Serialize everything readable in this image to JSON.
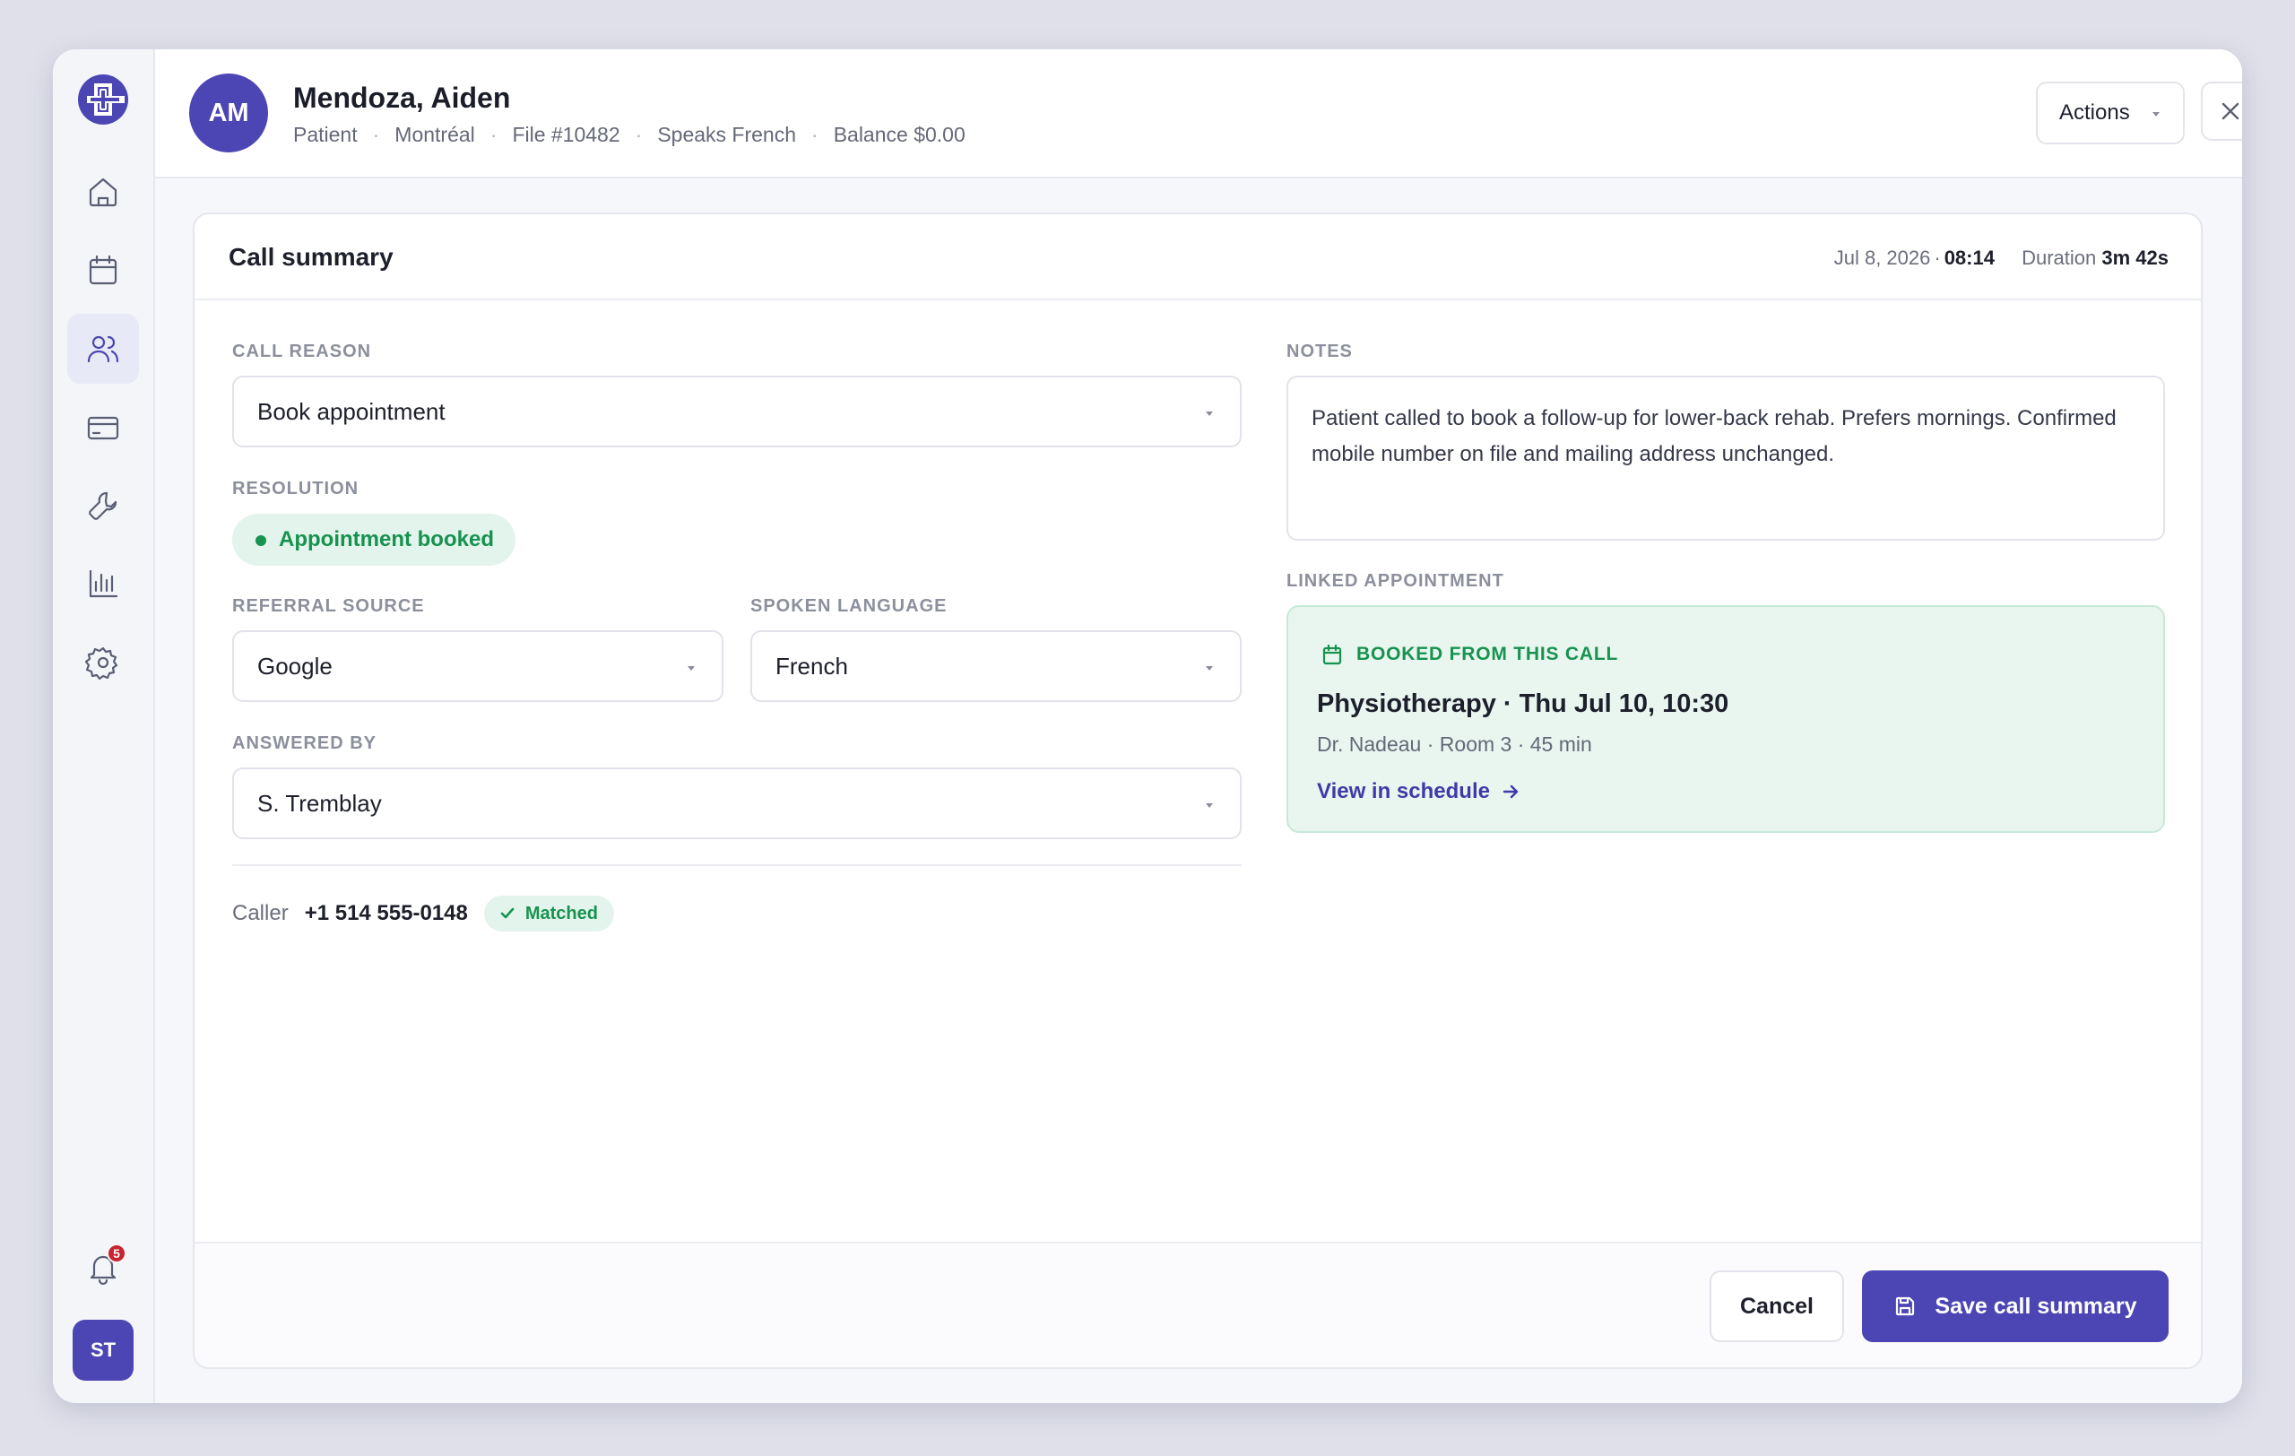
{
  "sidebar": {
    "items": [
      {
        "icon": "home-icon"
      },
      {
        "icon": "calendar-icon"
      },
      {
        "icon": "users-icon",
        "active": true
      },
      {
        "icon": "credit-card-icon"
      },
      {
        "icon": "wrench-icon"
      },
      {
        "icon": "bar-chart-icon"
      },
      {
        "icon": "gear-icon"
      }
    ],
    "notifications_count": "5",
    "user_initials": "ST"
  },
  "header": {
    "avatar_initials": "AM",
    "name": "Mendoza, Aiden",
    "meta": [
      "Patient",
      "Montréal",
      "File #10482",
      "Speaks French",
      "Balance $0.00"
    ],
    "actions_label": "Actions"
  },
  "card": {
    "title": "Call summary",
    "date": "Jul 8, 2026",
    "time": "08:14",
    "duration_label": "Duration",
    "duration": "3m 42s"
  },
  "form": {
    "call_reason": {
      "label": "Call reason",
      "value": "Book appointment"
    },
    "resolution": {
      "label": "Resolution",
      "value": "Appointment booked"
    },
    "referral_source": {
      "label": "Referral source",
      "value": "Google"
    },
    "spoken_language": {
      "label": "Spoken language",
      "value": "French"
    },
    "answered_by": {
      "label": "Answered by",
      "value": "S. Tremblay"
    },
    "caller": {
      "label": "Caller",
      "phone": "+1 514 555-0148",
      "status": "Matched"
    }
  },
  "notes": {
    "label": "Notes",
    "text": "Patient called to book a follow-up for lower-back rehab. Prefers mornings. Confirmed mobile number on file and mailing address unchanged."
  },
  "linked_appointment": {
    "label": "Linked appointment",
    "tag": "BOOKED FROM THIS CALL",
    "title": "Physiotherapy · Thu Jul 10, 10:30",
    "details": "Dr. Nadeau · Room 3 · 45 min",
    "link_label": "View in schedule"
  },
  "footer": {
    "cancel_label": "Cancel",
    "save_label": "Save call summary"
  },
  "colors": {
    "accent": "#4b46b3",
    "success": "#17924f",
    "success_bg": "#e3f4ec",
    "badge": "#c8232f"
  }
}
